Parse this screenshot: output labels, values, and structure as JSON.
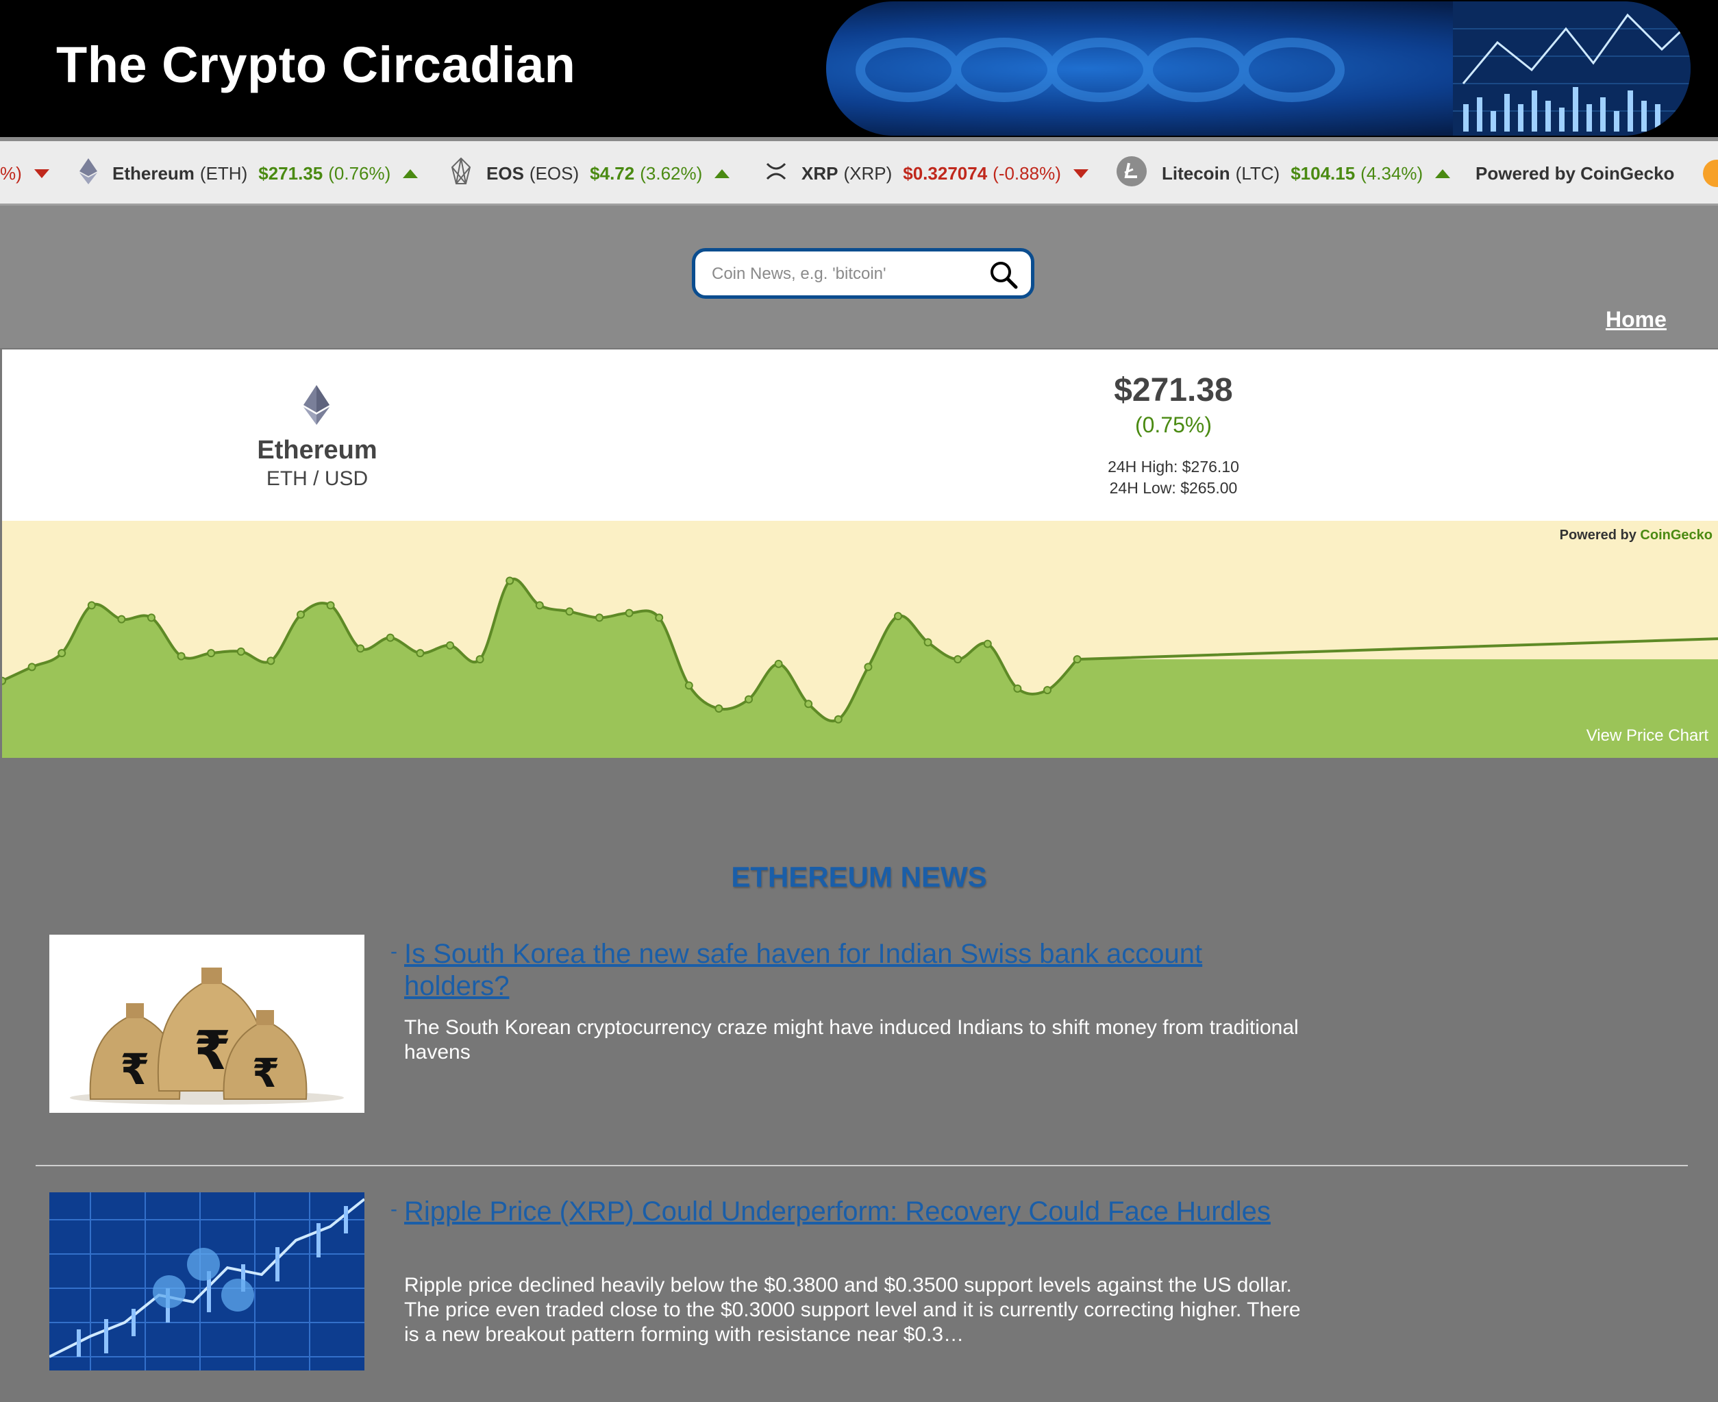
{
  "site": {
    "title": "The Crypto Circadian"
  },
  "ticker": [
    {
      "name": "Ethereum",
      "symbol": "(ETH)",
      "price": "$271.35",
      "change": "(0.76%)",
      "direction": "up",
      "icon": "ethereum-icon"
    },
    {
      "name": "EOS",
      "symbol": "(EOS)",
      "price": "$4.72",
      "change": "(3.62%)",
      "direction": "up",
      "icon": "eos-icon"
    },
    {
      "name": "XRP",
      "symbol": "(XRP)",
      "price": "$0.327074",
      "change": "(-0.88%)",
      "direction": "down",
      "icon": "xrp-icon"
    },
    {
      "name": "Litecoin",
      "symbol": "(LTC)",
      "price": "$104.15",
      "change": "(4.34%)",
      "direction": "up",
      "icon": "litecoin-icon"
    }
  ],
  "ticker_partial_left": "%)",
  "ticker_powered": "Powered by CoinGecko",
  "search": {
    "placeholder": "Coin News, e.g. 'bitcoin'"
  },
  "nav": {
    "home": "Home"
  },
  "coin": {
    "name": "Ethereum",
    "pair": "ETH / USD",
    "price": "$271.38",
    "change": "(0.75%)",
    "high": "24H High: $276.10",
    "low": "24H Low: $265.00"
  },
  "chart": {
    "powered_prefix": "Powered by ",
    "powered_brand": "CoinGecko",
    "view_link": "View Price Chart"
  },
  "chart_data": {
    "type": "area",
    "title": "",
    "values": [
      271.0,
      271.9,
      272.8,
      275.9,
      275.0,
      275.1,
      272.6,
      272.8,
      272.9,
      272.3,
      275.3,
      275.9,
      273.1,
      273.8,
      272.8,
      273.3,
      272.4,
      277.5,
      275.9,
      275.5,
      275.1,
      275.4,
      275.1,
      270.7,
      269.2,
      269.8,
      272.1,
      269.5,
      268.5,
      271.9,
      275.2,
      273.5,
      272.4,
      273.4,
      270.5,
      270.4,
      272.4
    ],
    "colors": {
      "fill": "#9bc458",
      "line": "#5e8a26",
      "background": "#fbf0c5"
    }
  },
  "news": {
    "heading": "ETHEREUM NEWS",
    "articles": [
      {
        "title": "Is South Korea the new safe haven for Indian Swiss bank account holders?",
        "description": "The South Korean cryptocurrency craze might have induced Indians to shift money from traditional havens"
      },
      {
        "title": "Ripple Price (XRP) Could Underperform: Recovery Could Face Hurdles",
        "description": "Ripple price declined heavily below the $0.3800 and $0.3500 support levels against the US dollar. The price even traded close to the $0.3000 support level and it is currently correcting higher. There is a new breakout pattern forming with resistance near $0.3…"
      }
    ]
  }
}
